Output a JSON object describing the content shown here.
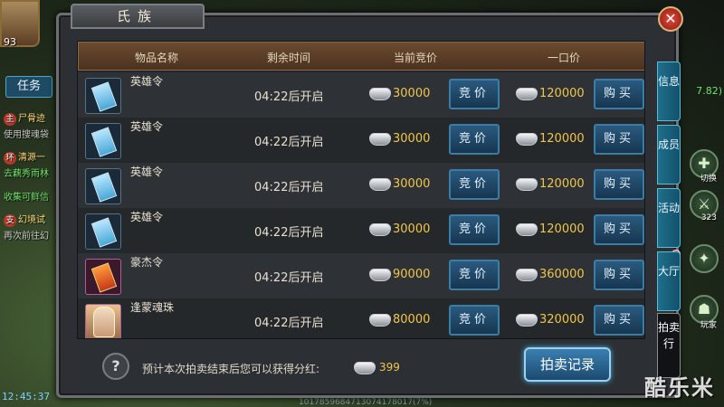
{
  "hud": {
    "level": "93",
    "task_tab": "任务",
    "quests": [
      {
        "tag": "主",
        "text": "尸骨迹",
        "sub": "使用搜魂袋"
      },
      {
        "tag": "环",
        "text": "清源一",
        "sub": "去藕秀雨林",
        "extra": "收集可鲜信"
      },
      {
        "tag": "支",
        "text": "幻境试",
        "sub": "再次前往幻"
      }
    ],
    "clock": "12:45:37",
    "coords": "7.82)",
    "right_icons": [
      {
        "name": "plus-icon",
        "glyph": "✚",
        "label": "切换"
      },
      {
        "name": "sword-icon",
        "glyph": "⚔",
        "label": "323"
      },
      {
        "name": "skill-icon",
        "glyph": "✦",
        "label": ""
      },
      {
        "name": "player-icon",
        "glyph": "☗",
        "label": "玩家"
      }
    ],
    "footer": "1017859684713074178017(7%)",
    "watermark": "酷乐米"
  },
  "panel": {
    "title": "氏族",
    "close_label": "✕",
    "headers": [
      "物品名称",
      "剩余时间",
      "当前竞价",
      "一口价"
    ],
    "bid_label": "竞价",
    "buy_label": "购买",
    "rows": [
      {
        "name": "英雄令",
        "icon": "blue",
        "time": "04:22后开启",
        "bid": "30000",
        "buyout": "120000"
      },
      {
        "name": "英雄令",
        "icon": "blue",
        "time": "04:22后开启",
        "bid": "30000",
        "buyout": "120000"
      },
      {
        "name": "英雄令",
        "icon": "blue",
        "time": "04:22后开启",
        "bid": "30000",
        "buyout": "120000"
      },
      {
        "name": "英雄令",
        "icon": "blue",
        "time": "04:22后开启",
        "bid": "30000",
        "buyout": "120000"
      },
      {
        "name": "豪杰令",
        "icon": "gold",
        "time": "04:22后开启",
        "bid": "90000",
        "buyout": "360000"
      },
      {
        "name": "逢蒙魂珠",
        "icon": "face",
        "time": "04:22后开启",
        "bid": "80000",
        "buyout": "320000"
      }
    ],
    "side_tabs": [
      "信息",
      "成员",
      "活动",
      "大厅",
      "拍卖行"
    ],
    "bonus_text": "预计本次拍卖结束后您可以获得分红:",
    "bonus_value": "399",
    "record_button": "拍卖记录",
    "help_label": "?"
  },
  "colors": {
    "price": "#f0c64a",
    "button": "#1f4a6a",
    "accent": "#5cbcd8"
  }
}
